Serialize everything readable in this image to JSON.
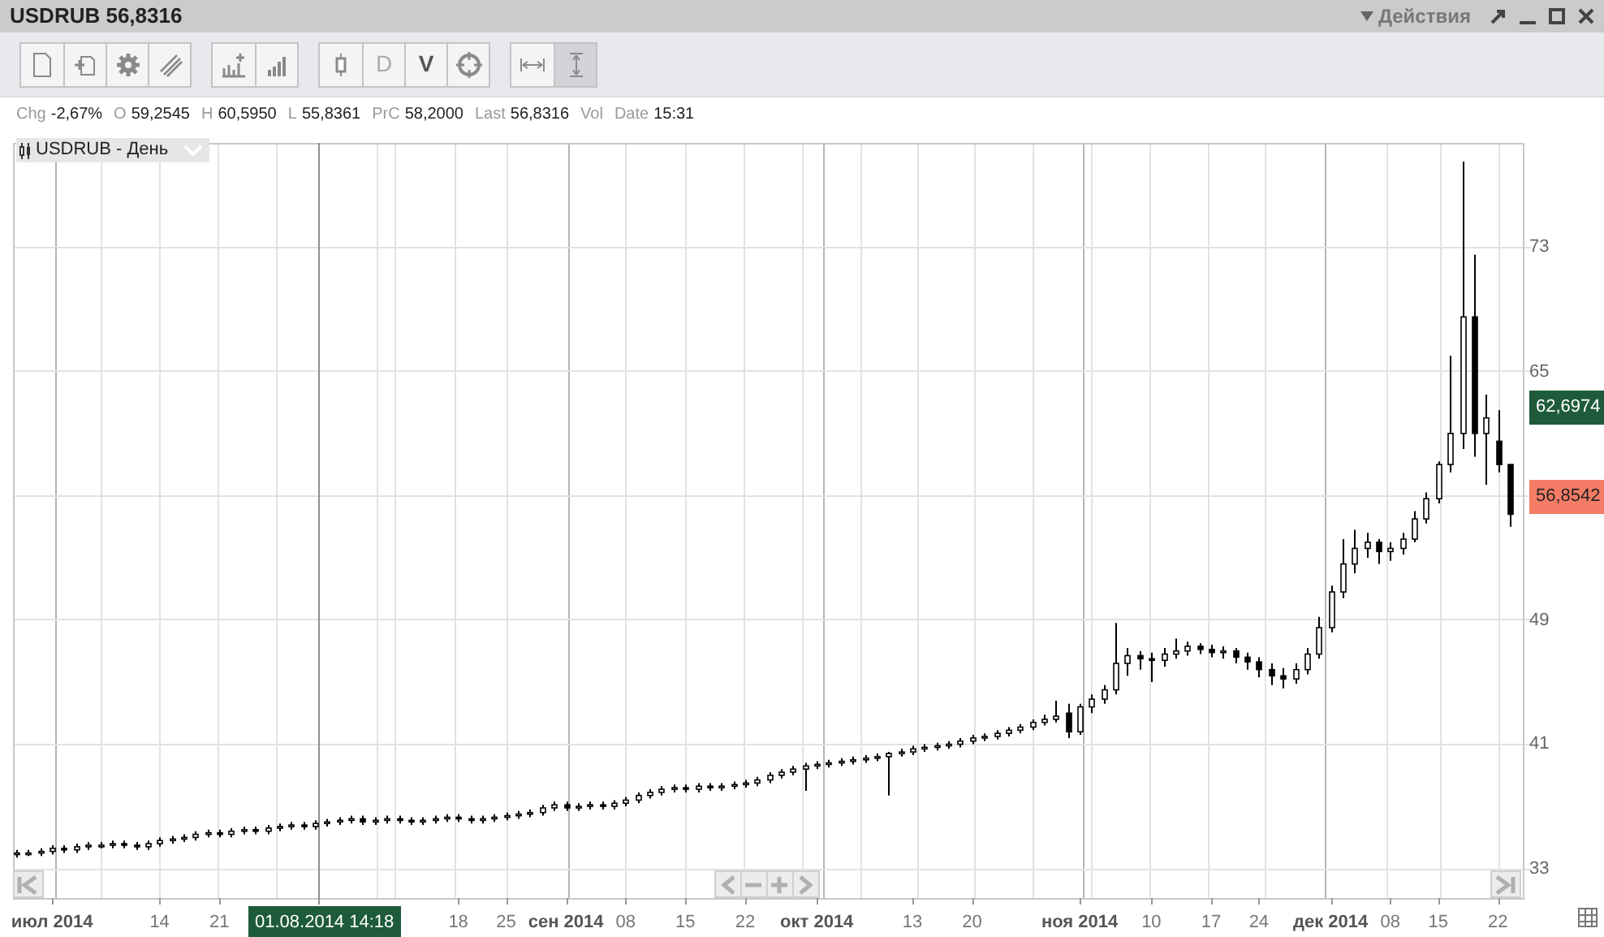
{
  "window": {
    "title": "USDRUB 56,8316",
    "actions_menu": "Действия"
  },
  "toolbar": {
    "groups": [
      [
        {
          "kind": "icon",
          "selected": false
        },
        {
          "kind": "icon",
          "selected": false
        },
        {
          "kind": "icon",
          "selected": false
        },
        {
          "kind": "icon",
          "selected": false
        }
      ],
      [
        {
          "kind": "icon",
          "selected": false
        },
        {
          "kind": "icon",
          "selected": false
        }
      ],
      [
        {
          "kind": "icon",
          "selected": false
        },
        {
          "kind": "text",
          "label": "D",
          "active": false,
          "selected": false
        },
        {
          "kind": "text",
          "label": "V",
          "active": true,
          "selected": false
        },
        {
          "kind": "icon",
          "selected": false
        }
      ],
      [
        {
          "kind": "icon",
          "selected": false
        },
        {
          "kind": "icon",
          "selected": true
        }
      ]
    ]
  },
  "stats": [
    {
      "label": "Chg",
      "value": "-2,67%"
    },
    {
      "label": "O",
      "value": "59,2545"
    },
    {
      "label": "H",
      "value": "60,5950"
    },
    {
      "label": "L",
      "value": "55,8361"
    },
    {
      "label": "PrC",
      "value": "58,2000"
    },
    {
      "label": "Last",
      "value": "56,8316"
    },
    {
      "label": "Vol"
    },
    {
      "label": "Date",
      "value": "15:31"
    }
  ],
  "chart": {
    "legend": "USDRUB - День",
    "price_markers": [
      {
        "value": "62,6974",
        "color": "#1e5b3a"
      },
      {
        "value": "56,8542",
        "color": "#f47c66"
      }
    ],
    "crosshair_label": "01.08.2014 14:18",
    "chart_data": {
      "type": "candlestick",
      "yticks": [
        33,
        41,
        49,
        65,
        73
      ],
      "ylim": [
        31.1,
        79.7
      ],
      "grid": true,
      "categories": [
        null,
        null,
        null,
        "июл 2014",
        null,
        null,
        null,
        null,
        null,
        null,
        null,
        null,
        "14",
        null,
        null,
        null,
        null,
        "21",
        null,
        null,
        null,
        null,
        null,
        null,
        null,
        null,
        null,
        null,
        null,
        null,
        null,
        null,
        null,
        null,
        null,
        null,
        null,
        "18",
        null,
        null,
        null,
        "25",
        null,
        null,
        null,
        null,
        "сен 2014",
        null,
        null,
        null,
        null,
        "08",
        null,
        null,
        null,
        null,
        "15",
        null,
        null,
        null,
        null,
        "22",
        null,
        null,
        null,
        null,
        null,
        "окт 2014",
        null,
        null,
        null,
        null,
        null,
        null,
        null,
        "13",
        null,
        null,
        null,
        null,
        "20",
        null,
        null,
        null,
        null,
        null,
        null,
        null,
        null,
        "ноя 2014",
        null,
        null,
        null,
        null,
        null,
        "10",
        null,
        null,
        null,
        null,
        "17",
        null,
        null,
        null,
        "24",
        null,
        null,
        null,
        null,
        null,
        "дек 2014",
        null,
        null,
        null,
        null,
        "08",
        null,
        null,
        null,
        "15",
        null,
        null,
        null,
        null,
        "22",
        null
      ],
      "ohlc": [
        [
          33.9,
          34.2,
          33.7,
          34.0
        ],
        [
          34.0,
          34.2,
          33.8,
          34.0
        ],
        [
          34.0,
          34.3,
          33.8,
          34.1
        ],
        [
          34.1,
          34.5,
          33.9,
          34.3
        ],
        [
          34.3,
          34.5,
          34.0,
          34.2
        ],
        [
          34.2,
          34.6,
          34.0,
          34.4
        ],
        [
          34.4,
          34.7,
          34.2,
          34.5
        ],
        [
          34.5,
          34.7,
          34.3,
          34.5
        ],
        [
          34.5,
          34.8,
          34.3,
          34.6
        ],
        [
          34.6,
          34.8,
          34.3,
          34.5
        ],
        [
          34.5,
          34.7,
          34.2,
          34.4
        ],
        [
          34.4,
          34.8,
          34.2,
          34.6
        ],
        [
          34.6,
          35.0,
          34.4,
          34.8
        ],
        [
          34.8,
          35.1,
          34.6,
          34.9
        ],
        [
          34.9,
          35.2,
          34.7,
          35.0
        ],
        [
          35.0,
          35.4,
          34.8,
          35.2
        ],
        [
          35.2,
          35.5,
          35.0,
          35.3
        ],
        [
          35.3,
          35.5,
          35.0,
          35.2
        ],
        [
          35.2,
          35.6,
          35.0,
          35.4
        ],
        [
          35.4,
          35.7,
          35.2,
          35.5
        ],
        [
          35.5,
          35.7,
          35.2,
          35.4
        ],
        [
          35.4,
          35.8,
          35.2,
          35.6
        ],
        [
          35.6,
          35.9,
          35.4,
          35.7
        ],
        [
          35.7,
          36.0,
          35.5,
          35.8
        ],
        [
          35.8,
          36.0,
          35.5,
          35.7
        ],
        [
          35.7,
          36.1,
          35.5,
          35.9
        ],
        [
          35.9,
          36.2,
          35.7,
          36.0
        ],
        [
          36.0,
          36.3,
          35.8,
          36.1
        ],
        [
          36.1,
          36.4,
          35.9,
          36.2
        ],
        [
          36.2,
          36.4,
          35.8,
          36.0
        ],
        [
          36.0,
          36.3,
          35.8,
          36.1
        ],
        [
          36.1,
          36.4,
          35.9,
          36.2
        ],
        [
          36.2,
          36.4,
          35.9,
          36.1
        ],
        [
          36.1,
          36.3,
          35.8,
          36.0
        ],
        [
          36.0,
          36.3,
          35.8,
          36.1
        ],
        [
          36.1,
          36.4,
          35.9,
          36.2
        ],
        [
          36.2,
          36.5,
          36.0,
          36.3
        ],
        [
          36.3,
          36.5,
          36.0,
          36.2
        ],
        [
          36.2,
          36.4,
          35.9,
          36.1
        ],
        [
          36.1,
          36.4,
          35.9,
          36.2
        ],
        [
          36.2,
          36.5,
          36.0,
          36.3
        ],
        [
          36.3,
          36.6,
          36.1,
          36.4
        ],
        [
          36.4,
          36.7,
          36.2,
          36.5
        ],
        [
          36.5,
          36.8,
          36.3,
          36.6
        ],
        [
          36.6,
          37.1,
          36.4,
          36.9
        ],
        [
          36.9,
          37.3,
          36.7,
          37.1
        ],
        [
          37.1,
          37.3,
          36.7,
          36.9
        ],
        [
          36.9,
          37.2,
          36.7,
          37.0
        ],
        [
          37.0,
          37.3,
          36.8,
          37.1
        ],
        [
          37.1,
          37.3,
          36.8,
          37.0
        ],
        [
          37.0,
          37.4,
          36.8,
          37.2
        ],
        [
          37.2,
          37.6,
          37.0,
          37.4
        ],
        [
          37.4,
          37.9,
          37.2,
          37.7
        ],
        [
          37.7,
          38.1,
          37.5,
          37.9
        ],
        [
          37.9,
          38.3,
          37.7,
          38.1
        ],
        [
          38.1,
          38.4,
          37.9,
          38.2
        ],
        [
          38.2,
          38.4,
          37.9,
          38.1
        ],
        [
          38.1,
          38.5,
          37.9,
          38.3
        ],
        [
          38.3,
          38.5,
          38.0,
          38.2
        ],
        [
          38.2,
          38.5,
          38.0,
          38.3
        ],
        [
          38.3,
          38.6,
          38.1,
          38.4
        ],
        [
          38.4,
          38.7,
          38.2,
          38.5
        ],
        [
          38.5,
          38.9,
          38.3,
          38.7
        ],
        [
          38.7,
          39.2,
          38.5,
          39.0
        ],
        [
          39.0,
          39.4,
          38.8,
          39.2
        ],
        [
          39.2,
          39.6,
          39.0,
          39.4
        ],
        [
          39.4,
          39.8,
          38.0,
          39.6
        ],
        [
          39.6,
          39.9,
          39.4,
          39.7
        ],
        [
          39.7,
          40.0,
          39.5,
          39.8
        ],
        [
          39.8,
          40.1,
          39.6,
          39.9
        ],
        [
          39.9,
          40.2,
          39.7,
          40.0
        ],
        [
          40.0,
          40.3,
          39.8,
          40.1
        ],
        [
          40.1,
          40.4,
          39.9,
          40.2
        ],
        [
          40.2,
          40.5,
          37.7,
          40.4
        ],
        [
          40.4,
          40.7,
          40.2,
          40.5
        ],
        [
          40.5,
          40.9,
          40.3,
          40.7
        ],
        [
          40.7,
          41.0,
          40.5,
          40.8
        ],
        [
          40.8,
          41.1,
          40.6,
          40.9
        ],
        [
          40.9,
          41.2,
          40.7,
          41.0
        ],
        [
          41.0,
          41.4,
          40.8,
          41.2
        ],
        [
          41.2,
          41.6,
          41.0,
          41.4
        ],
        [
          41.4,
          41.7,
          41.2,
          41.5
        ],
        [
          41.5,
          41.9,
          41.3,
          41.7
        ],
        [
          41.7,
          42.1,
          41.5,
          41.9
        ],
        [
          41.9,
          42.3,
          41.7,
          42.1
        ],
        [
          42.1,
          42.6,
          41.9,
          42.4
        ],
        [
          42.4,
          42.9,
          42.2,
          42.6
        ],
        [
          42.6,
          43.8,
          42.4,
          42.8
        ],
        [
          43.0,
          43.6,
          41.4,
          41.8
        ],
        [
          41.8,
          43.6,
          41.6,
          43.4
        ],
        [
          43.4,
          44.2,
          43.0,
          43.9
        ],
        [
          43.9,
          44.8,
          43.6,
          44.5
        ],
        [
          44.5,
          48.8,
          44.2,
          46.2
        ],
        [
          46.2,
          47.2,
          45.4,
          46.7
        ],
        [
          46.7,
          47.0,
          45.8,
          46.5
        ],
        [
          46.5,
          46.9,
          45.0,
          46.4
        ],
        [
          46.4,
          47.2,
          46.0,
          46.8
        ],
        [
          46.8,
          47.8,
          46.5,
          47.0
        ],
        [
          47.0,
          47.6,
          46.7,
          47.3
        ],
        [
          47.3,
          47.5,
          46.8,
          47.1
        ],
        [
          47.1,
          47.4,
          46.6,
          46.9
        ],
        [
          46.9,
          47.3,
          46.5,
          47.0
        ],
        [
          47.0,
          47.2,
          46.2,
          46.6
        ],
        [
          46.6,
          46.9,
          45.8,
          46.3
        ],
        [
          46.3,
          46.6,
          45.3,
          45.8
        ],
        [
          45.8,
          46.2,
          44.8,
          45.4
        ],
        [
          45.4,
          45.9,
          44.6,
          45.2
        ],
        [
          45.2,
          46.2,
          44.9,
          45.8
        ],
        [
          45.8,
          47.2,
          45.5,
          46.8
        ],
        [
          46.8,
          49.2,
          46.5,
          48.5
        ],
        [
          48.5,
          51.2,
          48.2,
          50.8
        ],
        [
          50.8,
          54.2,
          50.4,
          52.6
        ],
        [
          52.6,
          54.8,
          52.0,
          53.6
        ],
        [
          53.6,
          54.6,
          53.0,
          54.0
        ],
        [
          54.0,
          54.2,
          52.6,
          53.4
        ],
        [
          53.4,
          54.0,
          52.8,
          53.6
        ],
        [
          53.6,
          54.6,
          53.2,
          54.2
        ],
        [
          54.2,
          56.0,
          54.0,
          55.5
        ],
        [
          55.5,
          57.2,
          55.2,
          56.8
        ],
        [
          56.8,
          59.2,
          56.5,
          59.0
        ],
        [
          59.0,
          66.0,
          58.5,
          61.0
        ],
        [
          61.0,
          78.5,
          60.0,
          68.5
        ],
        [
          68.5,
          72.5,
          59.5,
          61.0
        ],
        [
          61.0,
          63.5,
          57.7,
          62.0
        ],
        [
          60.5,
          62.5,
          58.5,
          59.0
        ],
        [
          59.0,
          59.0,
          55.0,
          55.8
        ]
      ]
    }
  }
}
